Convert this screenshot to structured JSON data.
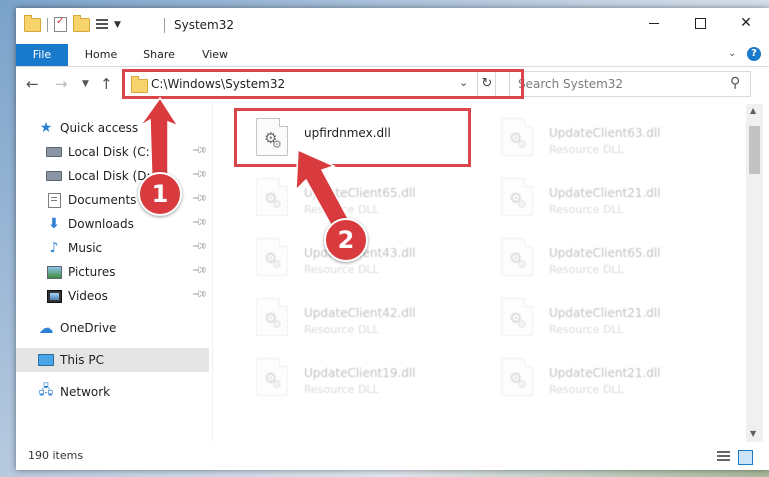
{
  "window": {
    "title": "System32",
    "controls": {
      "minimize": "",
      "maximize": "",
      "close": "✕"
    }
  },
  "ribbon": {
    "tabs": [
      "File",
      "Home",
      "Share",
      "View"
    ],
    "help": "?"
  },
  "address": {
    "path": "C:\\Windows\\System32",
    "search_placeholder": "Search System32"
  },
  "nav": {
    "items": [
      {
        "label": "Quick access",
        "icon": "star-icon"
      },
      {
        "label": "Local Disk (C:)",
        "icon": "disk-icon",
        "pinned": true
      },
      {
        "label": "Local Disk (D:)",
        "icon": "disk-icon",
        "pinned": true
      },
      {
        "label": "Documents",
        "icon": "documents-icon",
        "pinned": true
      },
      {
        "label": "Downloads",
        "icon": "downloads-icon",
        "pinned": true
      },
      {
        "label": "Music",
        "icon": "music-icon",
        "pinned": true
      },
      {
        "label": "Pictures",
        "icon": "pictures-icon",
        "pinned": true
      },
      {
        "label": "Videos",
        "icon": "videos-icon",
        "pinned": true
      },
      {
        "label": "OneDrive",
        "icon": "onedrive-icon"
      },
      {
        "label": "This PC",
        "icon": "this-pc-icon",
        "selected": true
      },
      {
        "label": "Network",
        "icon": "network-icon"
      }
    ]
  },
  "files": [
    {
      "name": "upfirdnmex.dll",
      "type": ""
    },
    {
      "name": "UpdateClient63.dll",
      "type": "Resource DLL"
    },
    {
      "name": "UpdateClient65.dll",
      "type": "Resource DLL"
    },
    {
      "name": "UpdateClient21.dll",
      "type": "Resource DLL"
    },
    {
      "name": "UpdateClient43.dll",
      "type": "Resource DLL"
    },
    {
      "name": "UpdateClient65.dll",
      "type": "Resource DLL"
    },
    {
      "name": "UpdateClient42.dll",
      "type": "Resource DLL"
    },
    {
      "name": "UpdateClient21.dll",
      "type": "Resource DLL"
    },
    {
      "name": "UpdateClient19.dll",
      "type": "Resource DLL"
    },
    {
      "name": "UpdateClient21.dll",
      "type": "Resource DLL"
    }
  ],
  "status": {
    "item_count": "190 items"
  },
  "annotations": {
    "step1": "1",
    "step2": "2",
    "color": "#d93a3e"
  },
  "colors": {
    "accent": "#1979ca",
    "annotation": "#d9464a"
  }
}
